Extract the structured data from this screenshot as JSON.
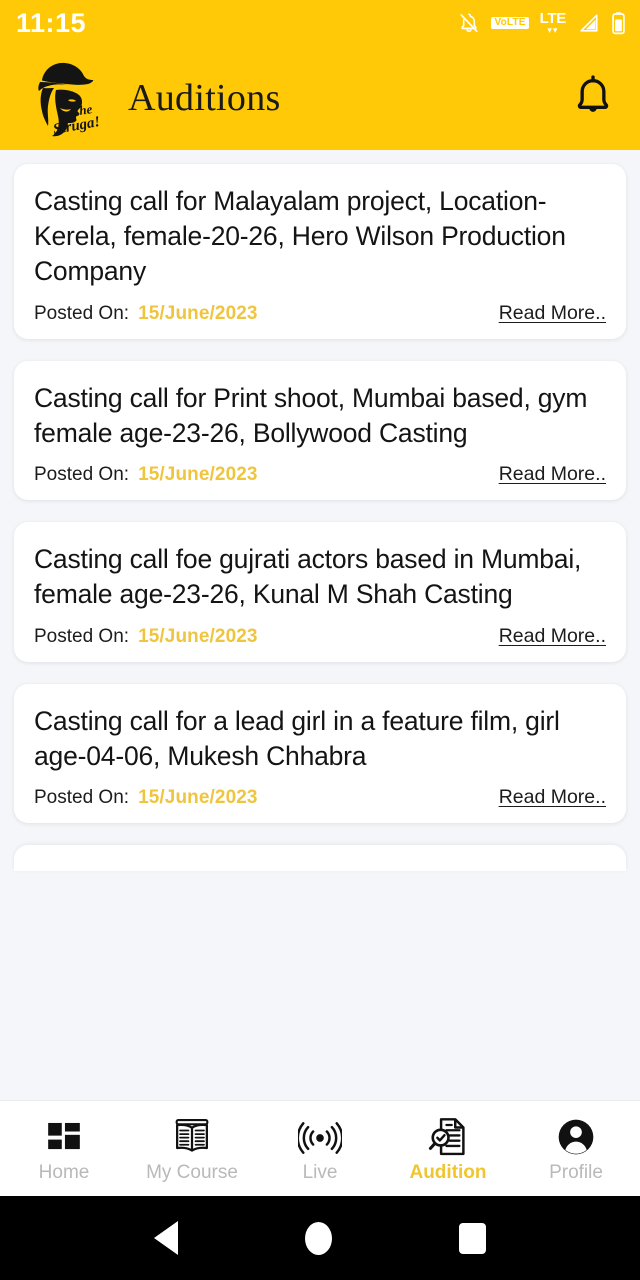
{
  "statusbar": {
    "time": "11:15",
    "icons": [
      {
        "name": "notifications-off-icon"
      },
      {
        "name": "volte-icon",
        "label": "VoLTE"
      },
      {
        "name": "lte-icon",
        "label": "LTE",
        "arrows": "▾▾"
      },
      {
        "name": "signal-icon"
      },
      {
        "name": "battery-icon"
      }
    ]
  },
  "appbar": {
    "title": "Auditions",
    "logo_name": "the-struggle-logo",
    "logo_script_top": "The",
    "logo_script_bottom": "Struga!",
    "bell_name": "notification-bell-icon"
  },
  "colors": {
    "brand_yellow": "#FFC907",
    "accent_yellow": "#EFC53F",
    "page_background": "#F4F6F9",
    "card_background": "#FFFFFF",
    "text_primary": "#141414",
    "nav_inactive": "#B9B9B9"
  },
  "list": {
    "posted_label": "Posted On:",
    "read_more_label": "Read More..",
    "cards": [
      {
        "title": "Casting call for Malayalam project, Location- Kerela, female-20-26, Hero Wilson Production Company",
        "date": "15/June/2023"
      },
      {
        "title": "Casting call for Print shoot, Mumbai based, gym female age-23-26, Bollywood Casting",
        "date": "15/June/2023"
      },
      {
        "title": "Casting call foe gujrati actors based in Mumbai, female age-23-26, Kunal M Shah Casting",
        "date": "15/June/2023"
      },
      {
        "title": "Casting call for a lead girl in a feature film, girl age-04-06, Mukesh Chhabra",
        "date": "15/June/2023"
      }
    ]
  },
  "bottomnav": {
    "items": [
      {
        "label": "Home",
        "icon": "grid-icon",
        "active": false
      },
      {
        "label": "My Course",
        "icon": "open-book-icon",
        "active": false
      },
      {
        "label": "Live",
        "icon": "broadcast-waves-icon",
        "active": false
      },
      {
        "label": "Audition",
        "icon": "document-search-icon",
        "active": true
      },
      {
        "label": "Profile",
        "icon": "person-circle-icon",
        "active": false
      }
    ]
  },
  "sysnav": {
    "back": "back-triangle",
    "home": "home-circle",
    "recents": "recents-square"
  }
}
